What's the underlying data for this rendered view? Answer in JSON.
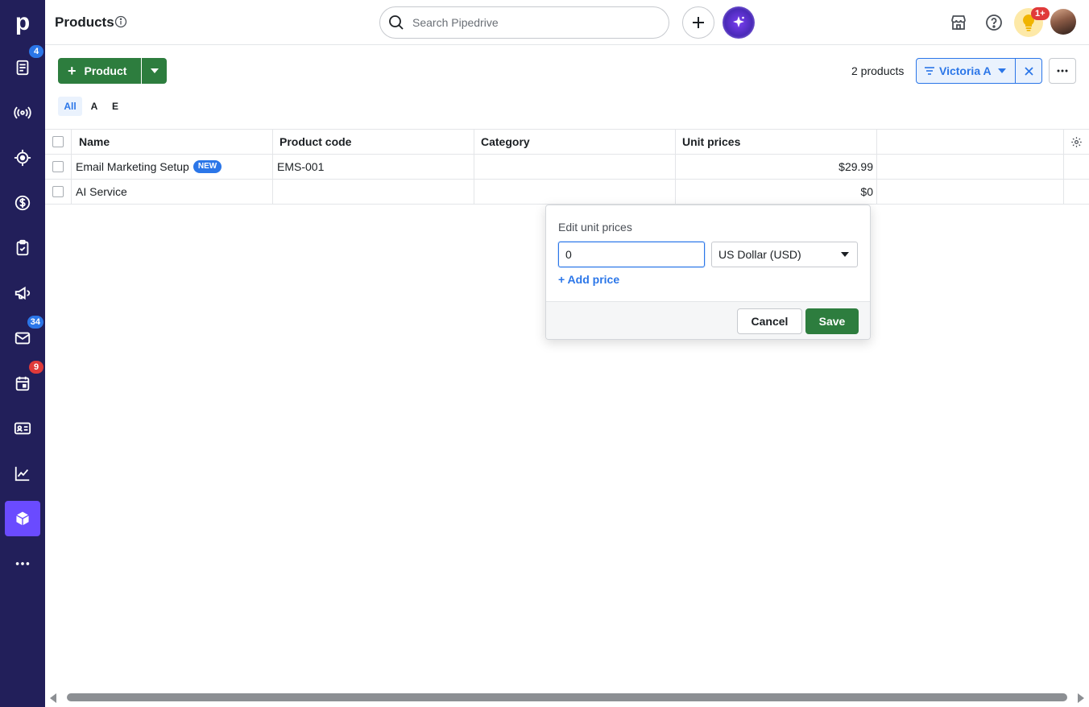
{
  "app": {
    "logo_letter": "p"
  },
  "sidebar": {
    "items": [
      {
        "icon": "leads-icon",
        "badge": "4"
      },
      {
        "icon": "broadcast-icon",
        "badge": ""
      },
      {
        "icon": "target-icon",
        "badge": ""
      },
      {
        "icon": "deals-dollar-icon",
        "badge": ""
      },
      {
        "icon": "activities-clipboard-icon",
        "badge": ""
      },
      {
        "icon": "campaigns-megaphone-icon",
        "badge": ""
      },
      {
        "icon": "mail-icon",
        "badge": "34"
      },
      {
        "icon": "calendar-icon",
        "badge": "9"
      },
      {
        "icon": "contacts-card-icon",
        "badge": ""
      },
      {
        "icon": "insights-chart-icon",
        "badge": ""
      },
      {
        "icon": "products-box-icon",
        "badge": "",
        "active": true
      },
      {
        "icon": "more-dots-icon",
        "badge": ""
      }
    ]
  },
  "header": {
    "title": "Products",
    "search_placeholder": "Search Pipedrive",
    "notification_badge": "1+"
  },
  "toolbar": {
    "add_label": "Product",
    "count_text": "2 products",
    "filter_label": "Victoria A",
    "alpha_filters": [
      "All",
      "A",
      "E"
    ],
    "active_alpha": "All"
  },
  "table": {
    "columns": [
      "Name",
      "Product code",
      "Category",
      "Unit prices"
    ],
    "rows": [
      {
        "name": "Email Marketing Setup",
        "badge": "NEW",
        "code": "EMS-001",
        "category": "",
        "price": "$29.99"
      },
      {
        "name": "AI Service",
        "badge": "",
        "code": "",
        "category": "",
        "price": "$0"
      }
    ]
  },
  "popover": {
    "title": "Edit unit prices",
    "price_value": "0",
    "currency": "US Dollar (USD)",
    "add_price_label": "+ Add price",
    "cancel_label": "Cancel",
    "save_label": "Save"
  },
  "colors": {
    "sidebar_bg": "#221f5a",
    "active_nav": "#6a4bff",
    "primary_green": "#2d7d3e",
    "accent_blue": "#2b76e8"
  }
}
